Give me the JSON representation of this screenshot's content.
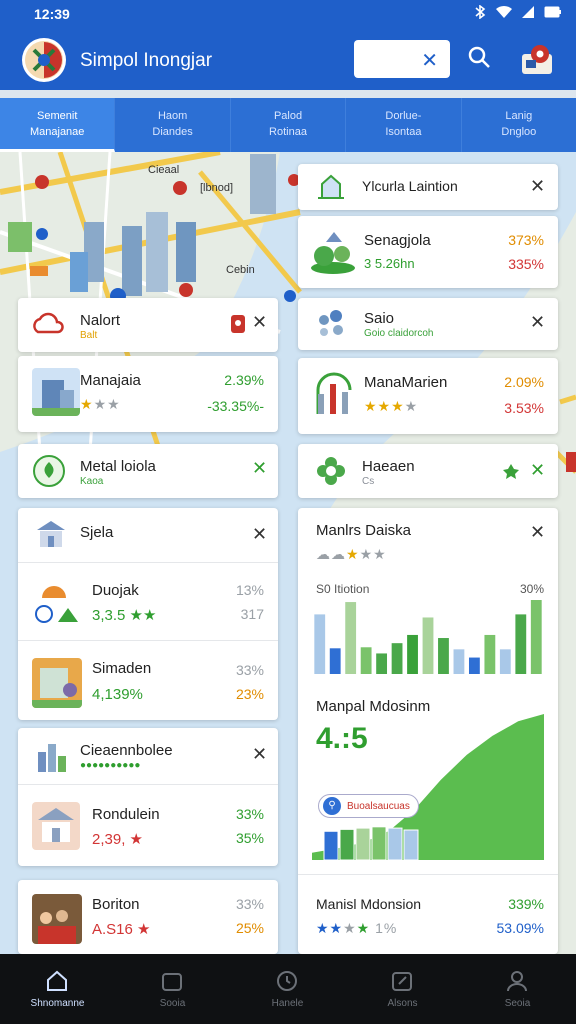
{
  "status": {
    "time": "12:39"
  },
  "app": {
    "title": "Simpol Inongjar"
  },
  "search": {
    "placeholder": ""
  },
  "tabs": [
    {
      "line1": "Semenit",
      "line2": "Manajanae"
    },
    {
      "line1": "Haom",
      "line2": "Diandes"
    },
    {
      "line1": "Palod",
      "line2": "Rotinaa"
    },
    {
      "line1": "Dorlue-",
      "line2": "Isontaa"
    },
    {
      "line1": "Lanig",
      "line2": "Dngloo"
    }
  ],
  "map_labels": {
    "l1": "Cieaal",
    "l2": "[lbnod]",
    "l3": "Cebin"
  },
  "left_cards": [
    {
      "title": "Nalort",
      "sub": "Balt"
    },
    {
      "title": "Manajaia",
      "stat1": "2.39%",
      "stat2": "-33.35%-"
    },
    {
      "title": "Metal loiola",
      "sub": "Kaoa"
    },
    {
      "title": "Sjela"
    },
    {
      "title": "Duojak",
      "value": "3,3.5",
      "stat1": "13%",
      "stat2": "317"
    },
    {
      "title": "Simaden",
      "value": "4,139%",
      "stat1": "33%",
      "stat2": "23%"
    },
    {
      "title": "Cieaennbolee"
    },
    {
      "title": "Rondulein",
      "value": "2,39,",
      "stat1": "33%",
      "stat2": "35%"
    },
    {
      "title": "Boriton",
      "value": "A.S16",
      "stat1": "33%",
      "stat2": "25%"
    }
  ],
  "right_cards": [
    {
      "title": "Ylcurla Laintion"
    },
    {
      "title": "Senagjola",
      "sub": "3 5.26hn",
      "stat1": "373%",
      "stat2": "335%"
    },
    {
      "title": "Saio",
      "sub": "Goio claidorcoh"
    },
    {
      "title": "ManaMarien",
      "stat1": "2.09%",
      "stat2": "3.53%"
    },
    {
      "title": "Haeaen",
      "sub": "Cs"
    },
    {
      "title": "Manlrs Daiska"
    },
    {
      "title": "Manpal Mdosinm",
      "value": "4.:5",
      "tag": "Buoalsaucuas"
    },
    {
      "title": "Manisl Mdonsion",
      "rating_pct": "1%",
      "stat1": "339%",
      "stat2": "53.09%"
    }
  ],
  "chart_data": [
    {
      "type": "bar",
      "title": "Manlrs Daiska",
      "ylabel_left": "S0 Itiotion",
      "ylabel_right": "30%",
      "values": [
        58,
        25,
        70,
        26,
        20,
        30,
        38,
        55,
        35,
        24,
        16,
        38,
        24,
        58,
        72
      ],
      "colors": [
        "#a9c8e8",
        "#2f6fd4",
        "#a9d39a",
        "#7ac36a",
        "#4aa84a",
        "#4aa84a",
        "#3aa13a",
        "#a9d39a",
        "#4aa84a",
        "#a9c8e8",
        "#2f6fd4",
        "#7ac36a",
        "#a9c8e8",
        "#4aa84a",
        "#7ac36a"
      ]
    },
    {
      "type": "area",
      "title": "Manpal Mdosinm",
      "values": [
        0.05,
        0.08,
        0.12,
        0.2,
        0.35,
        0.55,
        0.72,
        0.85,
        0.95,
        1.0
      ],
      "bars": [
        0.45,
        0.48,
        0.5,
        0.52,
        0.5,
        0.47
      ]
    }
  ],
  "nav": [
    {
      "label": "Shnomanne",
      "icon": "home-icon"
    },
    {
      "label": "Sooia",
      "icon": "calendar-icon"
    },
    {
      "label": "Hanele",
      "icon": "clock-icon"
    },
    {
      "label": "Alsons",
      "icon": "edit-icon"
    },
    {
      "label": "Seoia",
      "icon": "person-icon"
    }
  ]
}
